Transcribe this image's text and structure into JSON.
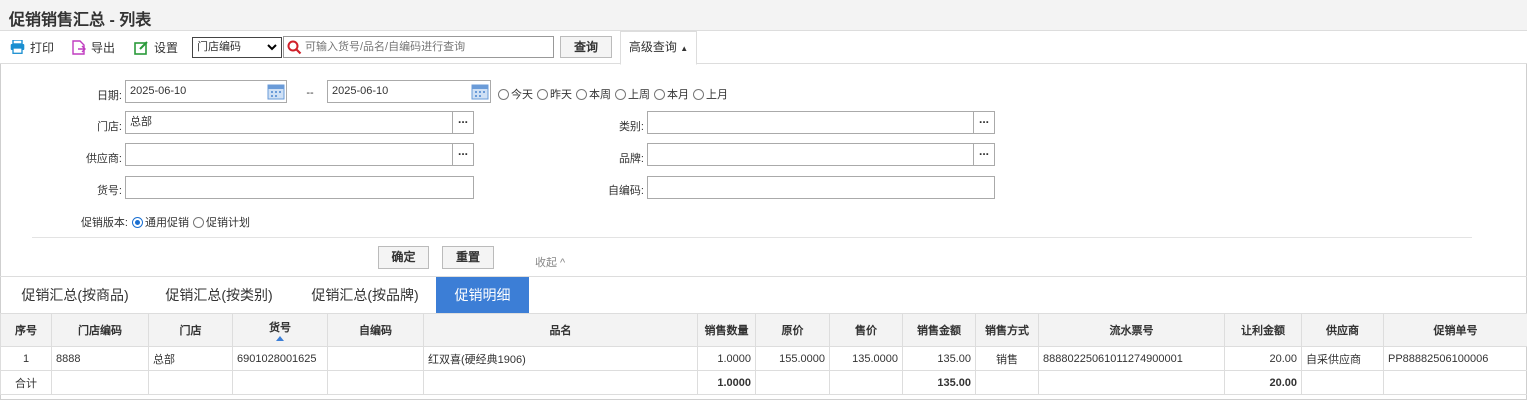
{
  "title": "促销销售汇总 - 列表",
  "toolbar": {
    "print": "打印",
    "export": "导出",
    "settings": "设置",
    "select_value": "门店编码",
    "search_placeholder": "可输入货号/品名/自编码进行查询",
    "query": "查询",
    "advanced": "高级查询"
  },
  "form": {
    "date_label": "日期:",
    "date_from": "2025-06-10",
    "date_sep": "--",
    "date_to": "2025-06-10",
    "quick": [
      "今天",
      "昨天",
      "本周",
      "上周",
      "本月",
      "上月"
    ],
    "store_label": "门店:",
    "store_value": "总部",
    "category_label": "类别:",
    "supplier_label": "供应商:",
    "brand_label": "品牌:",
    "item_label": "货号:",
    "selfcode_label": "自编码:",
    "version_label": "促销版本:",
    "version_options": [
      "通用促销",
      "促销计划"
    ],
    "confirm": "确定",
    "reset": "重置",
    "collapse": "收起 ^"
  },
  "tabs": [
    "促销汇总(按商品)",
    "促销汇总(按类别)",
    "促销汇总(按品牌)",
    "促销明细"
  ],
  "table": {
    "headers": [
      "序号",
      "门店编码",
      "门店",
      "货号",
      "自编码",
      "品名",
      "销售数量",
      "原价",
      "售价",
      "销售金额",
      "销售方式",
      "流水票号",
      "让利金额",
      "供应商",
      "促销单号"
    ],
    "row": [
      "1",
      "8888",
      "总部",
      "6901028001625",
      "",
      "红双喜(硬经典1906)",
      "1.0000",
      "155.0000",
      "135.0000",
      "135.00",
      "销售",
      "88880225061011274900001",
      "20.00",
      "自采供应商",
      "PP88882506100006"
    ],
    "total": {
      "label": "合计",
      "qty": "1.0000",
      "amount": "135.00",
      "discount": "20.00"
    }
  },
  "colors": {
    "accent": "#3c7ed6",
    "print_icon": "#1a8fd1",
    "export_icon": "#c03cc0",
    "settings_icon": "#2a9a3a",
    "search_icon": "#d0202a"
  }
}
